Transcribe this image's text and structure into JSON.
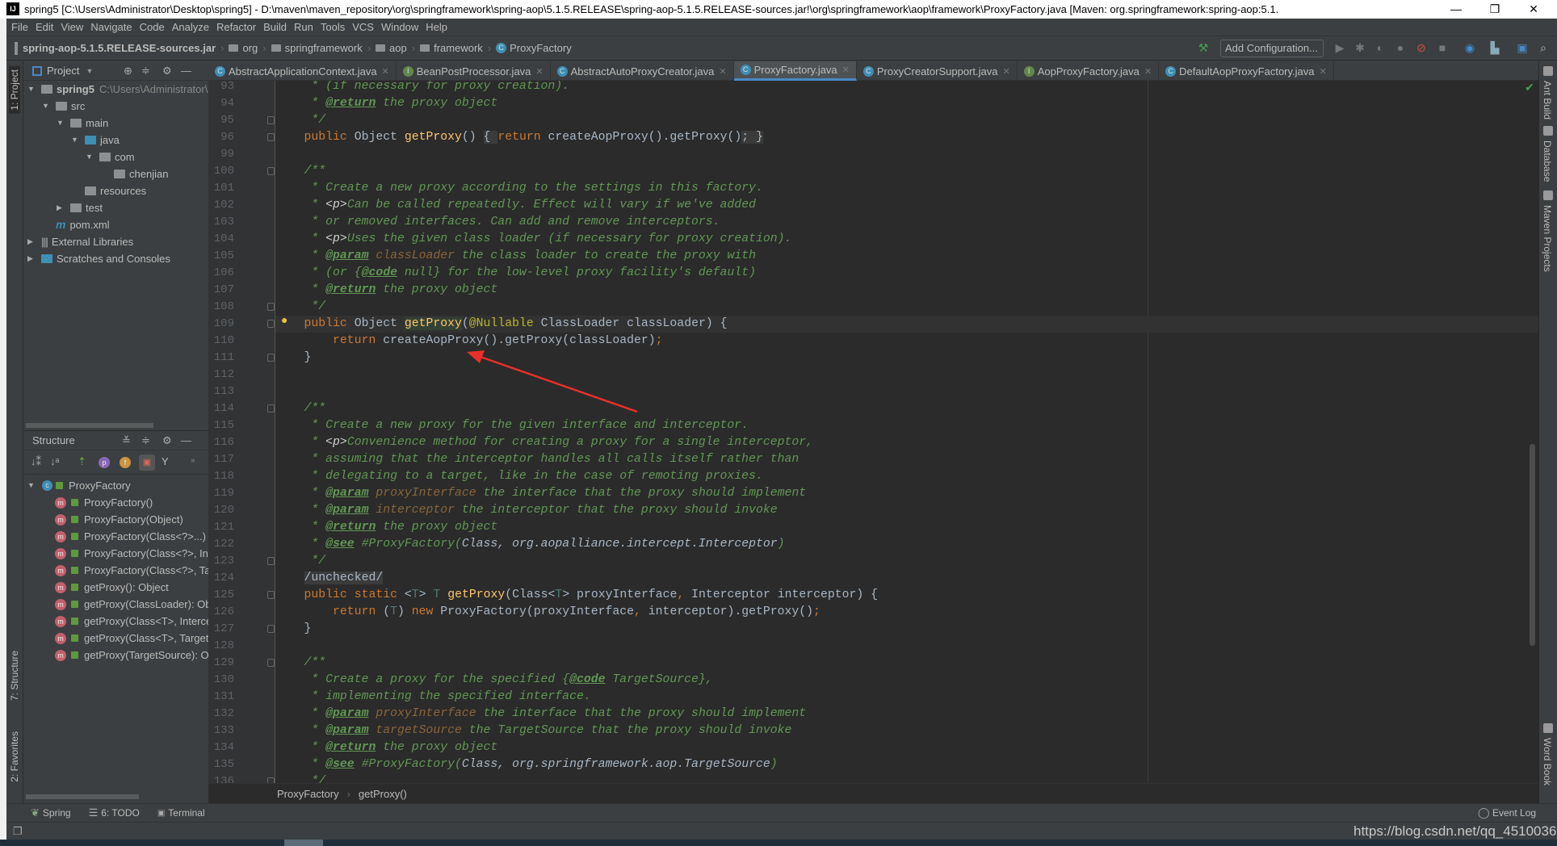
{
  "window": {
    "title": "spring5 [C:\\Users\\Administrator\\Desktop\\spring5] - D:\\maven\\maven_repository\\org\\springframework\\spring-aop\\5.1.5.RELEASE\\spring-aop-5.1.5.RELEASE-sources.jar!\\org\\springframework\\aop\\framework\\ProxyFactory.java [Maven: org.springframework:spring-aop:5.1.",
    "logo": "IJ",
    "minimize": "—",
    "restore": "❐",
    "close": "✕"
  },
  "menu": [
    "File",
    "Edit",
    "View",
    "Navigate",
    "Code",
    "Analyze",
    "Refactor",
    "Build",
    "Run",
    "Tools",
    "VCS",
    "Window",
    "Help"
  ],
  "navbar": {
    "crumbs": [
      "spring-aop-5.1.5.RELEASE-sources.jar",
      "org",
      "springframework",
      "aop",
      "framework",
      "ProxyFactory"
    ],
    "add_configuration": "Add Configuration..."
  },
  "left_stripe": {
    "project": "1: Project",
    "structure": "7: Structure",
    "favorites": "2: Favorites"
  },
  "right_stripe": [
    "Ant Build",
    "Database",
    "Maven Projects",
    "Word Book"
  ],
  "project": {
    "header": "Project",
    "tree": [
      {
        "label": "spring5",
        "path": "C:\\Users\\Administrator\\",
        "depth": 0,
        "arrow": "▼",
        "icon": "module"
      },
      {
        "label": "src",
        "depth": 1,
        "arrow": "▼",
        "icon": "folder"
      },
      {
        "label": "main",
        "depth": 2,
        "arrow": "▼",
        "icon": "folder"
      },
      {
        "label": "java",
        "depth": 3,
        "arrow": "▼",
        "icon": "source-folder"
      },
      {
        "label": "com",
        "depth": 4,
        "arrow": "▼",
        "icon": "package"
      },
      {
        "label": "chenjian",
        "depth": 5,
        "arrow": "",
        "icon": "package"
      },
      {
        "label": "resources",
        "depth": 3,
        "arrow": "",
        "icon": "resources-folder"
      },
      {
        "label": "test",
        "depth": 2,
        "arrow": "▶",
        "icon": "folder"
      },
      {
        "label": "pom.xml",
        "depth": 1,
        "arrow": "",
        "icon": "maven"
      },
      {
        "label": "External Libraries",
        "depth": 0,
        "arrow": "▶",
        "icon": "libraries"
      },
      {
        "label": "Scratches and Consoles",
        "depth": 0,
        "arrow": "▶",
        "icon": "scratches"
      }
    ]
  },
  "structure": {
    "header": "Structure",
    "root": "ProxyFactory",
    "members": [
      "ProxyFactory()",
      "ProxyFactory(Object)",
      "ProxyFactory(Class<?>...)",
      "ProxyFactory(Class<?>, Int",
      "ProxyFactory(Class<?>, Tar",
      "getProxy(): Object",
      "getProxy(ClassLoader): Ob",
      "getProxy(Class<T>, Interce",
      "getProxy(Class<T>, Target",
      "getProxy(TargetSource): O"
    ]
  },
  "tabs": [
    {
      "label": "AbstractApplicationContext.java",
      "kind": "c"
    },
    {
      "label": "BeanPostProcessor.java",
      "kind": "i"
    },
    {
      "label": "AbstractAutoProxyCreator.java",
      "kind": "c"
    },
    {
      "label": "ProxyFactory.java",
      "kind": "c",
      "active": true
    },
    {
      "label": "ProxyCreatorSupport.java",
      "kind": "c"
    },
    {
      "label": "AopProxyFactory.java",
      "kind": "i"
    },
    {
      "label": "DefaultAopProxyFactory.java",
      "kind": "c"
    }
  ],
  "code": [
    {
      "n": "93",
      "t": [
        [
          "d",
          "     * (if necessary for proxy creation)."
        ]
      ]
    },
    {
      "n": "94",
      "t": [
        [
          "d",
          "     * "
        ],
        [
          "g",
          "@return"
        ],
        [
          "d",
          " the proxy object"
        ]
      ]
    },
    {
      "n": "95",
      "f": 1,
      "t": [
        [
          "d",
          "     */"
        ]
      ]
    },
    {
      "n": "96",
      "f": 1,
      "t": [
        [
          "p",
          "    "
        ],
        [
          "k",
          "public"
        ],
        [
          "p",
          " Object "
        ],
        [
          "f",
          "getProxy"
        ],
        [
          "p",
          "() "
        ],
        [
          "b",
          "{ "
        ],
        [
          "k",
          "return"
        ],
        [
          "p",
          " createAopProxy().getProxy()"
        ],
        [
          "b",
          "; }"
        ]
      ]
    },
    {
      "n": "99",
      "t": []
    },
    {
      "n": "100",
      "f": 1,
      "t": [
        [
          "d",
          "    /**"
        ]
      ]
    },
    {
      "n": "101",
      "t": [
        [
          "d",
          "     * Create a new proxy according to the settings in this factory."
        ]
      ]
    },
    {
      "n": "102",
      "t": [
        [
          "d",
          "     * "
        ],
        [
          "h",
          "<p>"
        ],
        [
          "d",
          "Can be called repeatedly. Effect will vary if we've added"
        ]
      ]
    },
    {
      "n": "103",
      "t": [
        [
          "d",
          "     * or removed interfaces. Can add and remove interceptors."
        ]
      ]
    },
    {
      "n": "104",
      "t": [
        [
          "d",
          "     * "
        ],
        [
          "h",
          "<p>"
        ],
        [
          "d",
          "Uses the given class loader (if necessary for proxy creation)."
        ]
      ]
    },
    {
      "n": "105",
      "t": [
        [
          "d",
          "     * "
        ],
        [
          "g",
          "@param"
        ],
        [
          "d",
          " "
        ],
        [
          "a",
          "classLoader"
        ],
        [
          "d",
          " the class loader to create the proxy with"
        ]
      ]
    },
    {
      "n": "106",
      "t": [
        [
          "d",
          "     * (or {"
        ],
        [
          "g",
          "@code"
        ],
        [
          "d",
          " null} for the low-level proxy facility's default)"
        ]
      ]
    },
    {
      "n": "107",
      "t": [
        [
          "d",
          "     * "
        ],
        [
          "g",
          "@return"
        ],
        [
          "d",
          " the proxy object"
        ]
      ]
    },
    {
      "n": "108",
      "f": 1,
      "t": [
        [
          "d",
          "     */"
        ]
      ]
    },
    {
      "n": "109",
      "f": 1,
      "cur": 1,
      "t": [
        [
          "p",
          "    "
        ],
        [
          "k",
          "public"
        ],
        [
          "p",
          " Object "
        ],
        [
          "fh",
          "getProxy"
        ],
        [
          "p",
          "("
        ],
        [
          "n",
          "@Nullable"
        ],
        [
          "p",
          " ClassLoader classLoader) {"
        ]
      ]
    },
    {
      "n": "110",
      "t": [
        [
          "p",
          "        "
        ],
        [
          "k",
          "return"
        ],
        [
          "p",
          " createAopProxy().getProxy(classLoader)"
        ],
        [
          "k",
          ";"
        ]
      ]
    },
    {
      "n": "111",
      "f": 1,
      "t": [
        [
          "p",
          "    }"
        ]
      ]
    },
    {
      "n": "112",
      "t": []
    },
    {
      "n": "113",
      "t": []
    },
    {
      "n": "114",
      "f": 1,
      "t": [
        [
          "d",
          "    /**"
        ]
      ]
    },
    {
      "n": "115",
      "t": [
        [
          "d",
          "     * Create a new proxy for the given interface and interceptor."
        ]
      ]
    },
    {
      "n": "116",
      "t": [
        [
          "d",
          "     * "
        ],
        [
          "h",
          "<p>"
        ],
        [
          "d",
          "Convenience method for creating a proxy for a single interceptor,"
        ]
      ]
    },
    {
      "n": "117",
      "t": [
        [
          "d",
          "     * assuming that the interceptor handles all calls itself rather than"
        ]
      ]
    },
    {
      "n": "118",
      "t": [
        [
          "d",
          "     * delegating to a target, like in the case of remoting proxies."
        ]
      ]
    },
    {
      "n": "119",
      "t": [
        [
          "d",
          "     * "
        ],
        [
          "g",
          "@param"
        ],
        [
          "d",
          " "
        ],
        [
          "a",
          "proxyInterface"
        ],
        [
          "d",
          " the interface that the proxy should implement"
        ]
      ]
    },
    {
      "n": "120",
      "t": [
        [
          "d",
          "     * "
        ],
        [
          "g",
          "@param"
        ],
        [
          "d",
          " "
        ],
        [
          "a",
          "interceptor"
        ],
        [
          "d",
          " the interceptor that the proxy should invoke"
        ]
      ]
    },
    {
      "n": "121",
      "t": [
        [
          "d",
          "     * "
        ],
        [
          "g",
          "@return"
        ],
        [
          "d",
          " the proxy object"
        ]
      ]
    },
    {
      "n": "122",
      "t": [
        [
          "d",
          "     * "
        ],
        [
          "g",
          "@see"
        ],
        [
          "d",
          " #ProxyFactory("
        ],
        [
          "r",
          "Class, org.aopalliance.intercept.Interceptor"
        ],
        [
          "d",
          ")"
        ]
      ]
    },
    {
      "n": "123",
      "f": 1,
      "t": [
        [
          "d",
          "     */"
        ]
      ]
    },
    {
      "n": "124",
      "t": [
        [
          "p",
          "    "
        ],
        [
          "u",
          "/unchecked/"
        ]
      ]
    },
    {
      "n": "125",
      "f": 1,
      "t": [
        [
          "p",
          "    "
        ],
        [
          "k",
          "public static "
        ],
        [
          "p",
          "<"
        ],
        [
          "t",
          "T"
        ],
        [
          "p",
          "> "
        ],
        [
          "t",
          "T"
        ],
        [
          "p",
          " "
        ],
        [
          "f",
          "getProxy"
        ],
        [
          "p",
          "(Class<"
        ],
        [
          "t",
          "T"
        ],
        [
          "p",
          "> proxyInterface"
        ],
        [
          "k",
          ","
        ],
        [
          "p",
          " Interceptor interceptor) {"
        ]
      ]
    },
    {
      "n": "126",
      "t": [
        [
          "p",
          "        "
        ],
        [
          "k",
          "return"
        ],
        [
          "p",
          " ("
        ],
        [
          "t",
          "T"
        ],
        [
          "p",
          ") "
        ],
        [
          "k",
          "new"
        ],
        [
          "p",
          " ProxyFactory(proxyInterface"
        ],
        [
          "k",
          ","
        ],
        [
          "p",
          " interceptor).getProxy()"
        ],
        [
          "k",
          ";"
        ]
      ]
    },
    {
      "n": "127",
      "f": 1,
      "t": [
        [
          "p",
          "    }"
        ]
      ]
    },
    {
      "n": "128",
      "t": []
    },
    {
      "n": "129",
      "f": 1,
      "t": [
        [
          "d",
          "    /**"
        ]
      ]
    },
    {
      "n": "130",
      "t": [
        [
          "d",
          "     * Create a proxy for the specified {"
        ],
        [
          "g",
          "@code"
        ],
        [
          "d",
          " TargetSource},"
        ]
      ]
    },
    {
      "n": "131",
      "t": [
        [
          "d",
          "     * implementing the specified interface."
        ]
      ]
    },
    {
      "n": "132",
      "t": [
        [
          "d",
          "     * "
        ],
        [
          "g",
          "@param"
        ],
        [
          "d",
          " "
        ],
        [
          "a",
          "proxyInterface"
        ],
        [
          "d",
          " the interface that the proxy should implement"
        ]
      ]
    },
    {
      "n": "133",
      "t": [
        [
          "d",
          "     * "
        ],
        [
          "g",
          "@param"
        ],
        [
          "d",
          " "
        ],
        [
          "a",
          "targetSource"
        ],
        [
          "d",
          " the TargetSource that the proxy should invoke"
        ]
      ]
    },
    {
      "n": "134",
      "t": [
        [
          "d",
          "     * "
        ],
        [
          "g",
          "@return"
        ],
        [
          "d",
          " the proxy object"
        ]
      ]
    },
    {
      "n": "135",
      "t": [
        [
          "d",
          "     * "
        ],
        [
          "g",
          "@see"
        ],
        [
          "d",
          " #ProxyFactory("
        ],
        [
          "r",
          "Class, org.springframework.aop.TargetSource"
        ],
        [
          "d",
          ")"
        ]
      ]
    },
    {
      "n": "136",
      "f": 1,
      "t": [
        [
          "d",
          "     */"
        ]
      ]
    }
  ],
  "editor_breadcrumb": [
    "ProxyFactory",
    "getProxy()"
  ],
  "bottom_tools": {
    "spring": "Spring",
    "todo": "6: TODO",
    "terminal": "Terminal",
    "event_log": "Event Log"
  },
  "watermark": "https://blog.csdn.net/qq_45100361",
  "annotation": {
    "color": "#e8302a"
  }
}
